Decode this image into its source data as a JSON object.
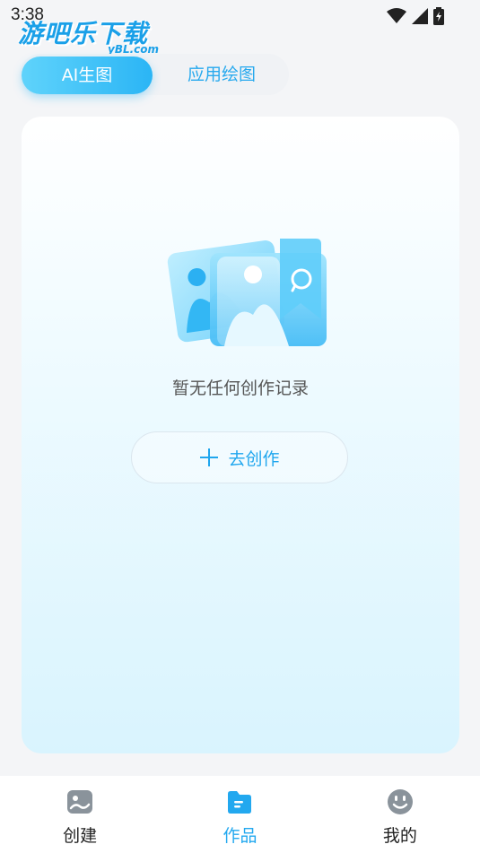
{
  "status_bar": {
    "time": "3:38",
    "icons": [
      "wifi-icon",
      "signal-icon",
      "battery-icon"
    ]
  },
  "watermark": {
    "main": "游吧乐下载",
    "sub": "yBL.com"
  },
  "tabs": [
    {
      "label": "AI生图",
      "active": true
    },
    {
      "label": "应用绘图",
      "active": false
    }
  ],
  "empty_state": {
    "illustration": "image-gallery-illustration",
    "message": "暂无任何创作记录",
    "button_label": "去创作",
    "button_icon": "plus-icon"
  },
  "bottom_nav": [
    {
      "label": "创建",
      "icon": "image-icon",
      "active": false
    },
    {
      "label": "作品",
      "icon": "folder-icon",
      "active": true
    },
    {
      "label": "我的",
      "icon": "smiley-icon",
      "active": false
    }
  ],
  "colors": {
    "accent": "#22a8ef",
    "tab_gradient_start": "#5fd3fb",
    "tab_gradient_end": "#2bb5f5",
    "nav_inactive_icon": "#8a939b"
  }
}
